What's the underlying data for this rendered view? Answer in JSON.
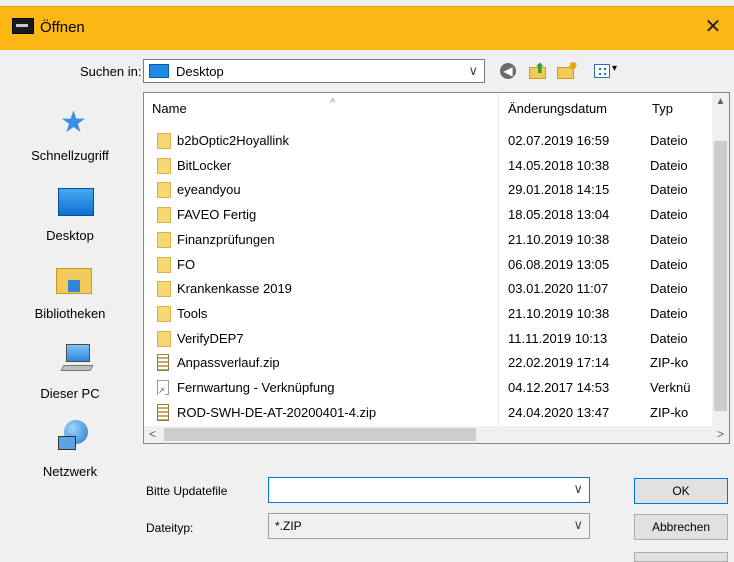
{
  "window": {
    "title": "Öffnen",
    "close_glyph": "✕"
  },
  "lookin": {
    "label": "Suchen in:",
    "value": "Desktop"
  },
  "toolbar": {
    "back_glyph": "◀",
    "up_glyph": "⬆",
    "new_folder_glyph": "✸",
    "view_menu_glyph": "▾"
  },
  "places": [
    {
      "label": "Schnellzugriff",
      "icon": "star-icon"
    },
    {
      "label": "Desktop",
      "icon": "desktop-icon"
    },
    {
      "label": "Bibliotheken",
      "icon": "libraries-icon"
    },
    {
      "label": "Dieser PC",
      "icon": "computer-icon"
    },
    {
      "label": "Netzwerk",
      "icon": "network-icon"
    }
  ],
  "columns": {
    "name": "Name",
    "date": "Änderungsdatum",
    "type": "Typ",
    "sort_glyph": "^"
  },
  "files": [
    {
      "name": "b2bOptic2Hoyallink",
      "date": "02.07.2019 16:59",
      "type": "Dateio",
      "kind": "folder"
    },
    {
      "name": "BitLocker",
      "date": "14.05.2018 10:38",
      "type": "Dateio",
      "kind": "folder"
    },
    {
      "name": "eyeandyou",
      "date": "29.01.2018 14:15",
      "type": "Dateio",
      "kind": "folder"
    },
    {
      "name": "FAVEO Fertig",
      "date": "18.05.2018 13:04",
      "type": "Dateio",
      "kind": "folder"
    },
    {
      "name": "Finanzprüfungen",
      "date": "21.10.2019 10:38",
      "type": "Dateio",
      "kind": "folder"
    },
    {
      "name": "FO",
      "date": "06.08.2019 13:05",
      "type": "Dateio",
      "kind": "folder"
    },
    {
      "name": "Krankenkasse 2019",
      "date": "03.01.2020 11:07",
      "type": "Dateio",
      "kind": "folder"
    },
    {
      "name": "Tools",
      "date": "21.10.2019 10:38",
      "type": "Dateio",
      "kind": "folder"
    },
    {
      "name": "VerifyDEP7",
      "date": "11.11.2019 10:13",
      "type": "Dateio",
      "kind": "folder"
    },
    {
      "name": "Anpassverlauf.zip",
      "date": "22.02.2019 17:14",
      "type": "ZIP-ko",
      "kind": "zip"
    },
    {
      "name": "Fernwartung - Verknüpfung",
      "date": "04.12.2017 14:53",
      "type": "Verknü",
      "kind": "shortcut"
    },
    {
      "name": "ROD-SWH-DE-AT-20200401-4.zip",
      "date": "24.04.2020 13:47",
      "type": "ZIP-ko",
      "kind": "zip"
    }
  ],
  "scroll": {
    "up": "▲",
    "down": "▼",
    "left": "<",
    "right": ">"
  },
  "filename": {
    "label": "Bitte Updatefile",
    "value": ""
  },
  "filetype": {
    "label": "Dateityp:",
    "value": "*.ZIP"
  },
  "chevron": "∨",
  "buttons": {
    "ok": "OK",
    "cancel": "Abbrechen"
  },
  "colors": {
    "titlebar": "#fdb714",
    "focus": "#0078d7"
  }
}
